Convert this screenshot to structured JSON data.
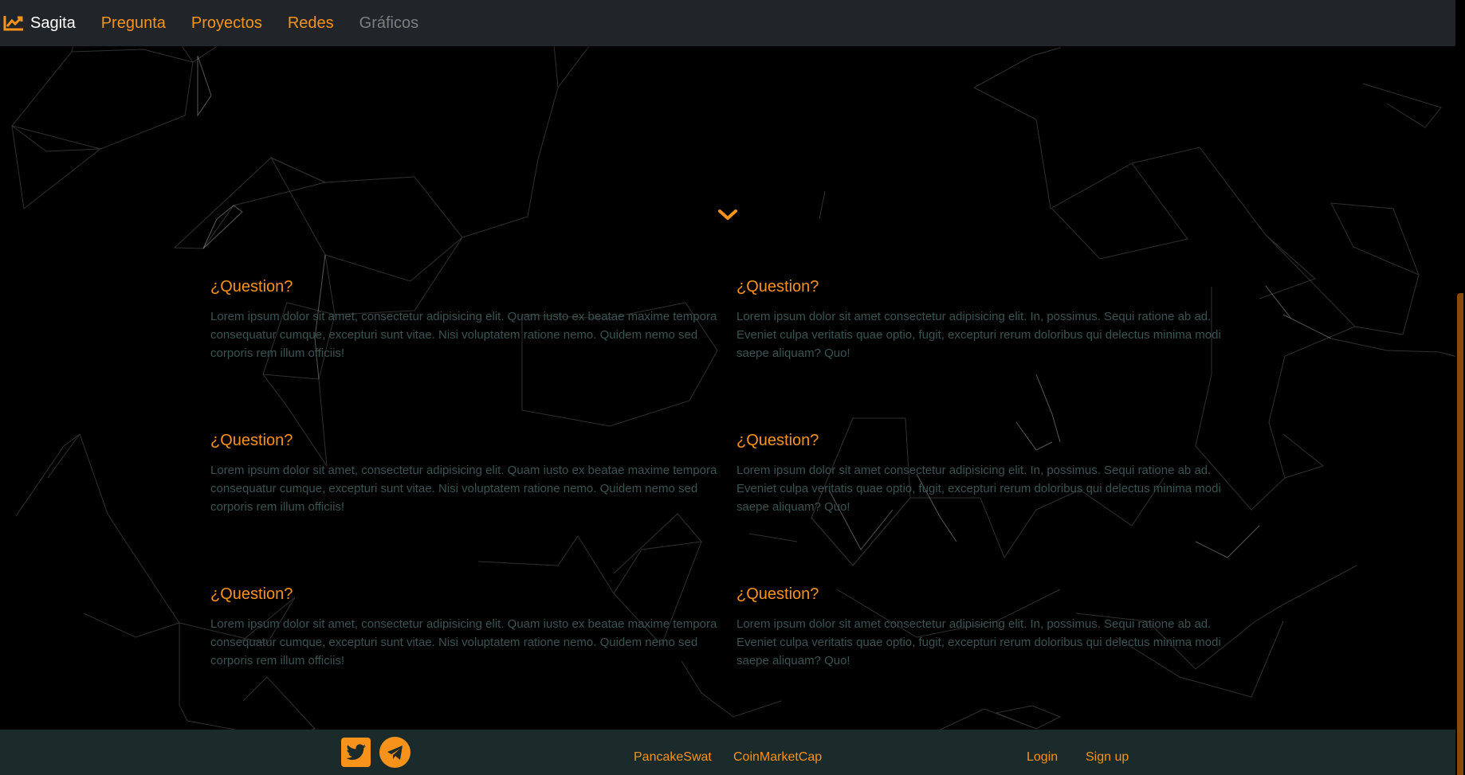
{
  "navbar": {
    "brand_label": "Sagita",
    "brand_icon": "chart-line-icon",
    "links": [
      {
        "label": "Pregunta",
        "state": "active"
      },
      {
        "label": "Proyectos",
        "state": "active"
      },
      {
        "label": "Redes",
        "state": "active"
      },
      {
        "label": "Gráficos",
        "state": "disabled"
      }
    ]
  },
  "scroll_down_icon": "chevron-down-icon",
  "faq": [
    {
      "question": "¿Question?",
      "answer": "Lorem ipsum dolor sit amet, consectetur adipisicing elit. Quam iusto ex beatae maxime tempora consequatur cumque, excepturi sunt vitae. Nisi voluptatem ratione nemo. Quidem nemo sed corporis rem illum officiis!"
    },
    {
      "question": "¿Question?",
      "answer": "Lorem ipsum dolor sit amet consectetur adipisicing elit. In, possimus. Sequi ratione ab ad. Eveniet culpa veritatis quae optio, fugit, excepturi rerum doloribus qui delectus minima modi saepe aliquam? Quo!"
    },
    {
      "question": "¿Question?",
      "answer": "Lorem ipsum dolor sit amet, consectetur adipisicing elit. Quam iusto ex beatae maxime tempora consequatur cumque, excepturi sunt vitae. Nisi voluptatem ratione nemo. Quidem nemo sed corporis rem illum officiis!"
    },
    {
      "question": "¿Question?",
      "answer": "Lorem ipsum dolor sit amet consectetur adipisicing elit. In, possimus. Sequi ratione ab ad. Eveniet culpa veritatis quae optio, fugit, excepturi rerum doloribus qui delectus minima modi saepe aliquam? Quo!"
    },
    {
      "question": "¿Question?",
      "answer": "Lorem ipsum dolor sit amet, consectetur adipisicing elit. Quam iusto ex beatae maxime tempora consequatur cumque, excepturi sunt vitae. Nisi voluptatem ratione nemo. Quidem nemo sed corporis rem illum officiis!"
    },
    {
      "question": "¿Question?",
      "answer": "Lorem ipsum dolor sit amet consectetur adipisicing elit. In, possimus. Sequi ratione ab ad. Eveniet culpa veritatis quae optio, fugit, excepturi rerum doloribus qui delectus minima modi saepe aliquam? Quo!"
    }
  ],
  "footer": {
    "social": [
      {
        "icon": "twitter-icon"
      },
      {
        "icon": "telegram-icon"
      }
    ],
    "links": [
      "PancakeSwat",
      "CoinMarketCap"
    ],
    "auth": {
      "login": "Login",
      "signup": "Sign up"
    }
  },
  "colors": {
    "accent": "#f7931a",
    "navbar_bg": "#212529",
    "footer_bg": "#1b2a2a",
    "page_bg": "#000000",
    "answer_text": "#3a5353",
    "disabled_link": "#7c7e80"
  }
}
